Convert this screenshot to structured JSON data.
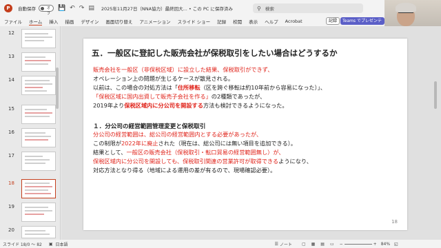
{
  "titlebar": {
    "app_logo": "P",
    "autosave_label": "自動保存",
    "toggle_state": "オフ",
    "doc_title": "2025年11月27日（NNA協力）最終回大...  •  この PC に保存済み",
    "search_placeholder": "検索"
  },
  "ribbon": {
    "tabs": [
      "ファイル",
      "ホーム",
      "挿入",
      "描画",
      "デザイン",
      "画面切り替え",
      "アニメーション",
      "スライド ショー",
      "記録",
      "校閲",
      "表示",
      "ヘルプ",
      "Acrobat"
    ],
    "record_label": "記録",
    "teams_label": "Teams でプレゼンテ"
  },
  "thumbnails": [
    {
      "num": "12",
      "active": false
    },
    {
      "num": "13",
      "active": false
    },
    {
      "num": "14",
      "active": false
    },
    {
      "num": "15",
      "active": false
    },
    {
      "num": "16",
      "active": false
    },
    {
      "num": "17",
      "active": false
    },
    {
      "num": "18",
      "active": true
    },
    {
      "num": "19",
      "active": false
    },
    {
      "num": "20",
      "active": false
    }
  ],
  "slide": {
    "title": "五．一般区に登記した販売会社が保税取引をしたい場合はどうするか",
    "p1_l1": "販売会社を一般区（非保税区域）に設立した結果、保税取引ができず、",
    "p1_l2": "オペレーション上の問題が生じるケースが散見される。",
    "p1_l3": "以前は、この場合の対処方法は「",
    "p1_l3_red": "住所移転",
    "p1_l3_end": "（区を跨ぐ移転は約10年前から容易になった）」、",
    "p1_l4_red": "「保税区域に国内出資して販売子会社を作る」",
    "p1_l4_end": "の2種類であったが、",
    "p1_l5_a": "2019年より",
    "p1_l5_red": "保税区域内に分公司を開設する",
    "p1_l5_end": "方法も検討できるようになった。",
    "sec_heading": "１．分公司の経営範囲管理変更と保税取引",
    "s_l1": "分公司の経営範囲は、総公司の経営範囲内とする必要があったが、",
    "s_l2_a": "この制限が",
    "s_l2_red": "2022年に廃止",
    "s_l2_end": "された（現在は、総公司には無い項目を追加できる）。",
    "s_l3_a": "結果として、",
    "s_l3_red": "一般区の販売会社（保税取引・転口貿易の経営範囲無し）が、",
    "s_l4_red": "保税区域内に分公司を開設しても、保税取引関連の営業許可が取得できる",
    "s_l4_end": "ようになり、",
    "s_l5": "対応方法となり得る（地域による運用の差が有るので、現場確認必要）。",
    "page_num": "18"
  },
  "statusbar": {
    "slide_info": "スライド 18/0 ～ 82",
    "language": "日本語",
    "notes": "ノート",
    "zoom": "84%"
  }
}
